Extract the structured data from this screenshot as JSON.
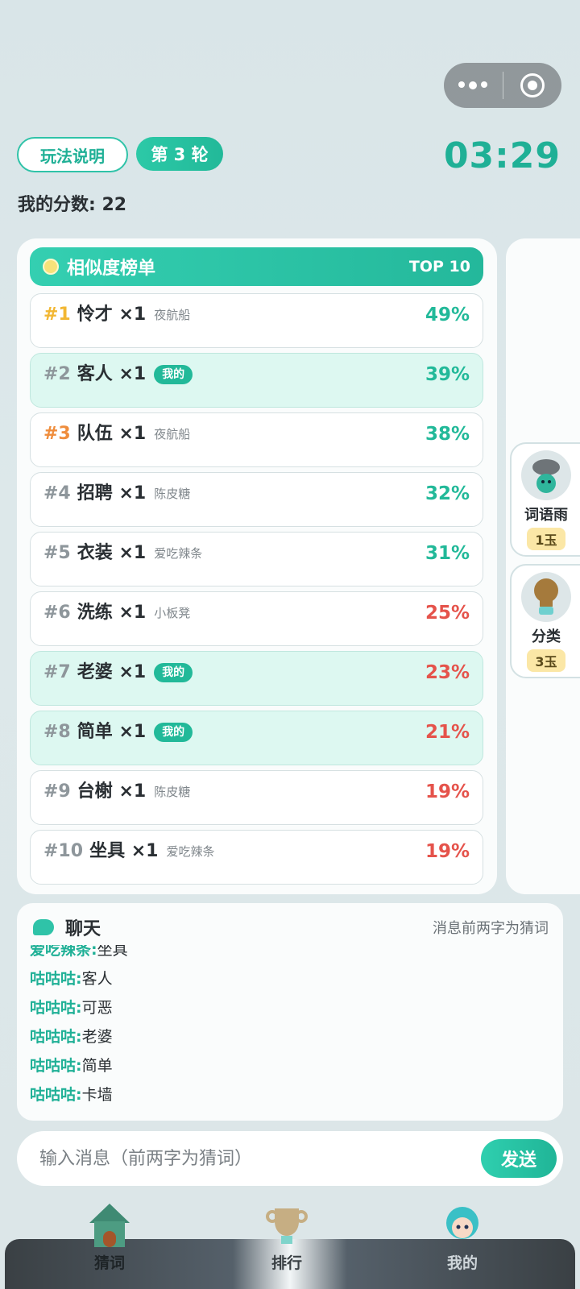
{
  "header": {
    "rules_label": "玩法说明",
    "round_label": "第 3 轮",
    "timer": "03:29",
    "score_label": "我的分数: 22"
  },
  "board": {
    "title": "相似度榜单",
    "top_label": "TOP 10",
    "rows": [
      {
        "rank": "#1",
        "word": "怜才",
        "count": "×1",
        "user": "夜航船",
        "mine": false,
        "pct": "49%",
        "color": "green"
      },
      {
        "rank": "#2",
        "word": "客人",
        "count": "×1",
        "tag": "我的",
        "mine": true,
        "pct": "39%",
        "color": "green"
      },
      {
        "rank": "#3",
        "word": "队伍",
        "count": "×1",
        "user": "夜航船",
        "mine": false,
        "pct": "38%",
        "color": "green"
      },
      {
        "rank": "#4",
        "word": "招聘",
        "count": "×1",
        "user": "陈皮糖",
        "mine": false,
        "pct": "32%",
        "color": "green"
      },
      {
        "rank": "#5",
        "word": "衣装",
        "count": "×1",
        "user": "爱吃辣条",
        "mine": false,
        "pct": "31%",
        "color": "green"
      },
      {
        "rank": "#6",
        "word": "洗练",
        "count": "×1",
        "user": "小板凳",
        "mine": false,
        "pct": "25%",
        "color": "red"
      },
      {
        "rank": "#7",
        "word": "老婆",
        "count": "×1",
        "tag": "我的",
        "mine": true,
        "pct": "23%",
        "color": "red"
      },
      {
        "rank": "#8",
        "word": "简单",
        "count": "×1",
        "tag": "我的",
        "mine": true,
        "pct": "21%",
        "color": "red"
      },
      {
        "rank": "#9",
        "word": "台榭",
        "count": "×1",
        "user": "陈皮糖",
        "mine": false,
        "pct": "19%",
        "color": "red"
      },
      {
        "rank": "#10",
        "word": "坐具",
        "count": "×1",
        "user": "爱吃辣条",
        "mine": false,
        "pct": "19%",
        "color": "red"
      }
    ]
  },
  "tools": [
    {
      "name": "词语雨",
      "cost": "1玉"
    },
    {
      "name": "分类",
      "cost": "3玉"
    }
  ],
  "chat": {
    "title": "聊天",
    "hint": "消息前两字为猜词",
    "messages": [
      {
        "sender": "爱吃辣条:",
        "text": "坐具"
      },
      {
        "sender": "咕咕咕:",
        "text": "客人"
      },
      {
        "sender": "咕咕咕:",
        "text": "可恶"
      },
      {
        "sender": "咕咕咕:",
        "text": "老婆"
      },
      {
        "sender": "咕咕咕:",
        "text": "简单"
      },
      {
        "sender": "咕咕咕:",
        "text": "卡墙"
      }
    ]
  },
  "input": {
    "placeholder": "输入消息（前两字为猜词）",
    "send_label": "发送"
  },
  "tabbar": {
    "tabs": [
      {
        "label": "猜词",
        "icon": "house-icon",
        "active": true
      },
      {
        "label": "排行",
        "icon": "trophy-icon",
        "active": false
      },
      {
        "label": "我的",
        "icon": "avatar-icon",
        "active": false
      }
    ]
  },
  "colors": {
    "accent": "#22b999",
    "gold": "#f2b733",
    "bronze": "#ef8d3d",
    "red": "#e5534b"
  }
}
